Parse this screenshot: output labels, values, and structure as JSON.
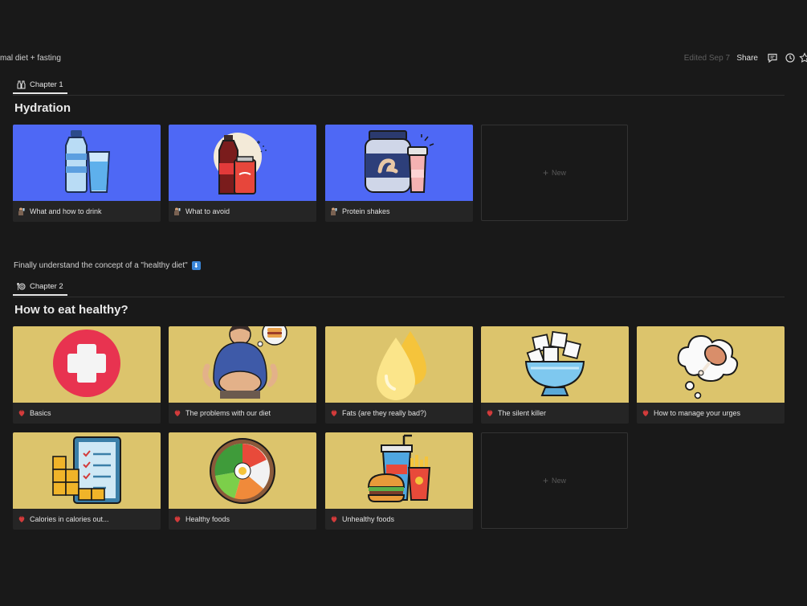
{
  "topbar": {
    "breadcrumb": "mal diet + fasting",
    "edited": "Edited Sep 7",
    "share": "Share"
  },
  "chapter1": {
    "tab_label": "Chapter 1",
    "heading": "Hydration",
    "cards": [
      {
        "title": "What and how to drink",
        "cover_icon": "water-bottle-glass-icon"
      },
      {
        "title": "What to avoid",
        "cover_icon": "soda-bottle-can-icon"
      },
      {
        "title": "Protein shakes",
        "cover_icon": "protein-jar-shaker-icon"
      }
    ],
    "new_label": "New"
  },
  "section_note": "Finally understand the concept of a \"healthy diet\"",
  "chapter2": {
    "tab_label": "Chapter 2",
    "heading": "How to eat healthy?",
    "cards": [
      {
        "title": "Basics",
        "cover_icon": "medical-cross-icon"
      },
      {
        "title": "The problems with our diet",
        "cover_icon": "overweight-person-icon"
      },
      {
        "title": "Fats (are they really bad?)",
        "cover_icon": "oil-drops-icon"
      },
      {
        "title": "The silent killer",
        "cover_icon": "sugar-cubes-bowl-icon"
      },
      {
        "title": "How to manage your urges",
        "cover_icon": "craving-thought-icon"
      },
      {
        "title": "Calories in calories out...",
        "cover_icon": "checklist-boxes-icon"
      },
      {
        "title": "Healthy foods",
        "cover_icon": "healthy-bowl-icon"
      },
      {
        "title": "Unhealthy foods",
        "cover_icon": "fast-food-icon"
      }
    ],
    "new_label": "New"
  },
  "colors": {
    "background": "#191919",
    "card": "#252525",
    "cover_blue": "#4e68f5",
    "cover_yellow": "#dcc46c"
  }
}
